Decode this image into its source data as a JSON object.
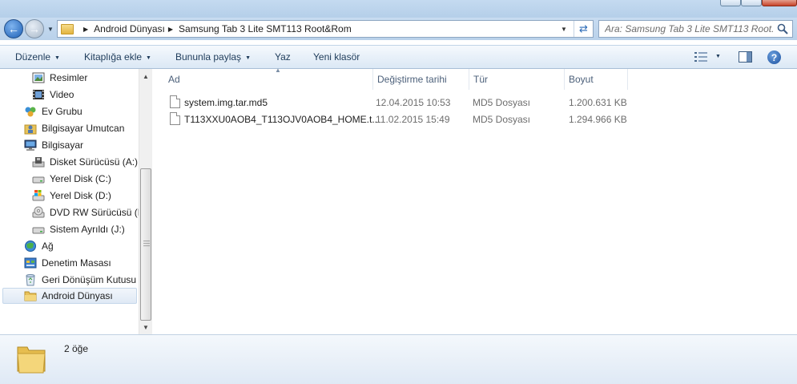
{
  "address": {
    "crumbs": [
      "Android Dünyası",
      "Samsung Tab 3 Lite SMT113 Root&Rom"
    ]
  },
  "search": {
    "placeholder": "Ara: Samsung Tab 3 Lite SMT113 Root..."
  },
  "toolbar": {
    "organize": "Düzenle",
    "include_in_library": "Kitaplığa ekle",
    "share_with": "Bunun­la paylaş",
    "burn": "Yaz",
    "new_folder": "Yeni klasör"
  },
  "sidebar": {
    "items": [
      {
        "label": "Resimler",
        "icon": "pictures-icon"
      },
      {
        "label": "Video",
        "icon": "video-icon"
      },
      {
        "label": "Ev Grubu",
        "icon": "homegroup-icon"
      },
      {
        "label": "Bilgisayar Umutcan",
        "icon": "user-folder-icon"
      },
      {
        "label": "Bilgisayar",
        "icon": "computer-icon"
      },
      {
        "label": "Disket Sürücüsü (A:)",
        "icon": "floppy-drive-icon"
      },
      {
        "label": "Yerel Disk (C:)",
        "icon": "hard-disk-icon"
      },
      {
        "label": "Yerel Disk (D:)",
        "icon": "windows-disk-icon"
      },
      {
        "label": "DVD RW Sürücüsü (E",
        "icon": "dvd-drive-icon"
      },
      {
        "label": "Sistem Ayrıldı (J:)",
        "icon": "hard-disk-icon"
      },
      {
        "label": "Ağ",
        "icon": "network-icon"
      },
      {
        "label": "Denetim Masası",
        "icon": "control-panel-icon"
      },
      {
        "label": "Geri Dönüşüm Kutusu",
        "icon": "recycle-bin-icon"
      },
      {
        "label": "Android Dünyası",
        "icon": "folder-icon"
      }
    ]
  },
  "columns": {
    "name": "Ad",
    "date_modified": "Değiştirme tarihi",
    "type": "Tür",
    "size": "Boyut"
  },
  "files": [
    {
      "name": "system.img.tar.md5",
      "date": "12.04.2015 10:53",
      "type": "MD5 Dosyası",
      "size": "1.200.631 KB"
    },
    {
      "name": "T113XXU0AOB4_T113OJV0AOB4_HOME.t...",
      "date": "11.02.2015 15:49",
      "type": "MD5 Dosyası",
      "size": "1.294.966 KB"
    }
  ],
  "details": {
    "item_count": "2 öğe"
  }
}
